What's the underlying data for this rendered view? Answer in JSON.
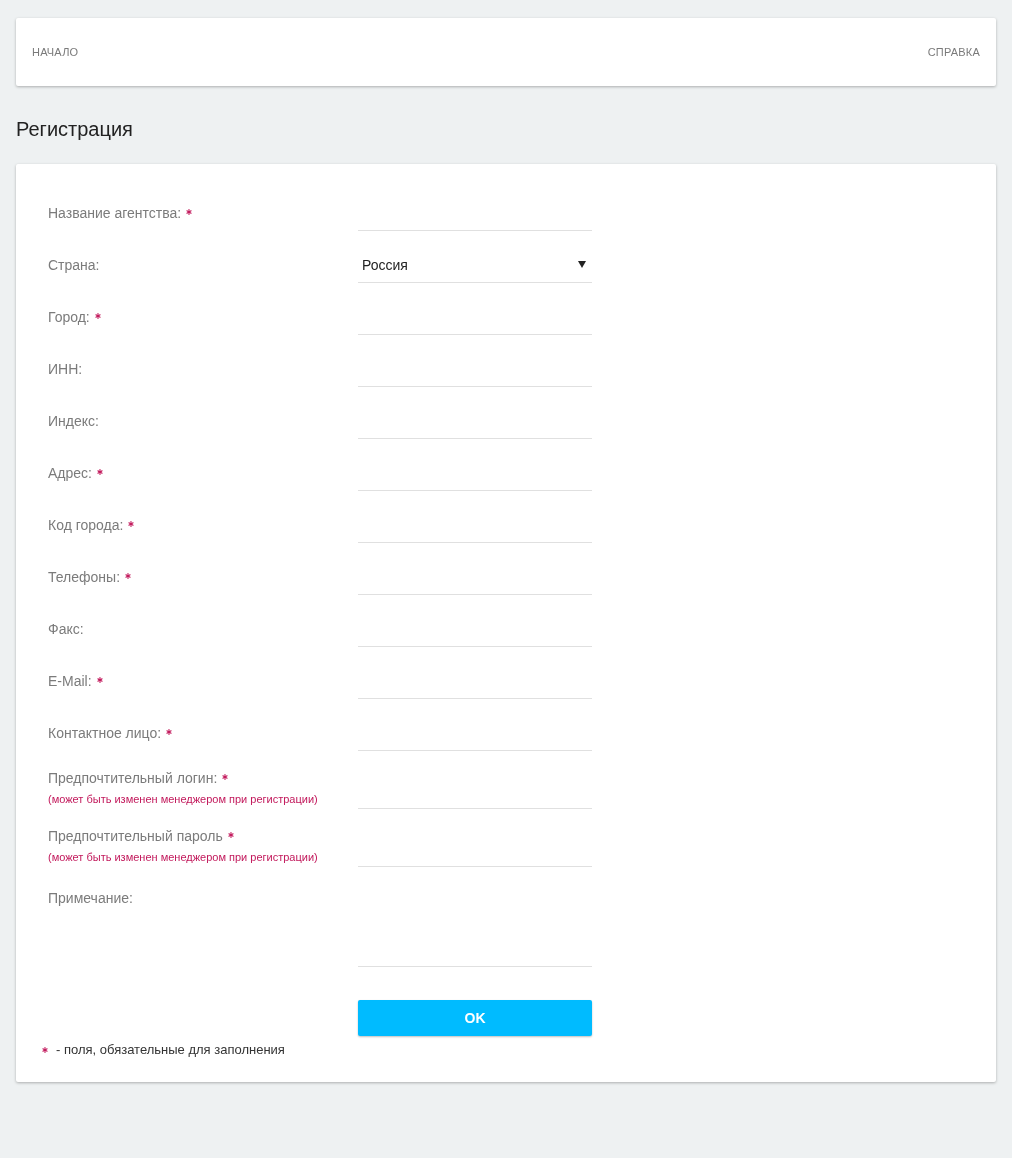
{
  "nav": {
    "items": [
      {
        "label": "НАЧАЛО"
      },
      {
        "label": "СПРАВКА"
      }
    ]
  },
  "page_title": "Регистрация",
  "form": {
    "fields": [
      {
        "label": "Название агентства:",
        "required": true,
        "kind": "text"
      },
      {
        "label": "Страна:",
        "required": false,
        "kind": "select",
        "value": "Россия"
      },
      {
        "label": "Город:",
        "required": true,
        "kind": "text"
      },
      {
        "label": "ИНН:",
        "required": false,
        "kind": "text"
      },
      {
        "label": "Индекс:",
        "required": false,
        "kind": "text"
      },
      {
        "label": "Адрес:",
        "required": true,
        "kind": "text"
      },
      {
        "label": "Код города:",
        "required": true,
        "kind": "text"
      },
      {
        "label": "Телефоны:",
        "required": true,
        "kind": "text"
      },
      {
        "label": "Факс:",
        "required": false,
        "kind": "text"
      },
      {
        "label": "E-Mail:",
        "required": true,
        "kind": "text"
      },
      {
        "label": "Контактное лицо:",
        "required": true,
        "kind": "text"
      },
      {
        "label": "Предпочтительный логин:",
        "required": true,
        "kind": "text",
        "hint": "(может быть изменен менеджером при регистрации)"
      },
      {
        "label": "Предпочтительный пароль",
        "required": true,
        "kind": "text",
        "hint": "(может быть изменен менеджером при регистрации)"
      },
      {
        "label": "Примечание:",
        "required": false,
        "kind": "textarea"
      }
    ],
    "submit_button": "OK",
    "footnote": "- поля, обязательные для заполнения"
  }
}
